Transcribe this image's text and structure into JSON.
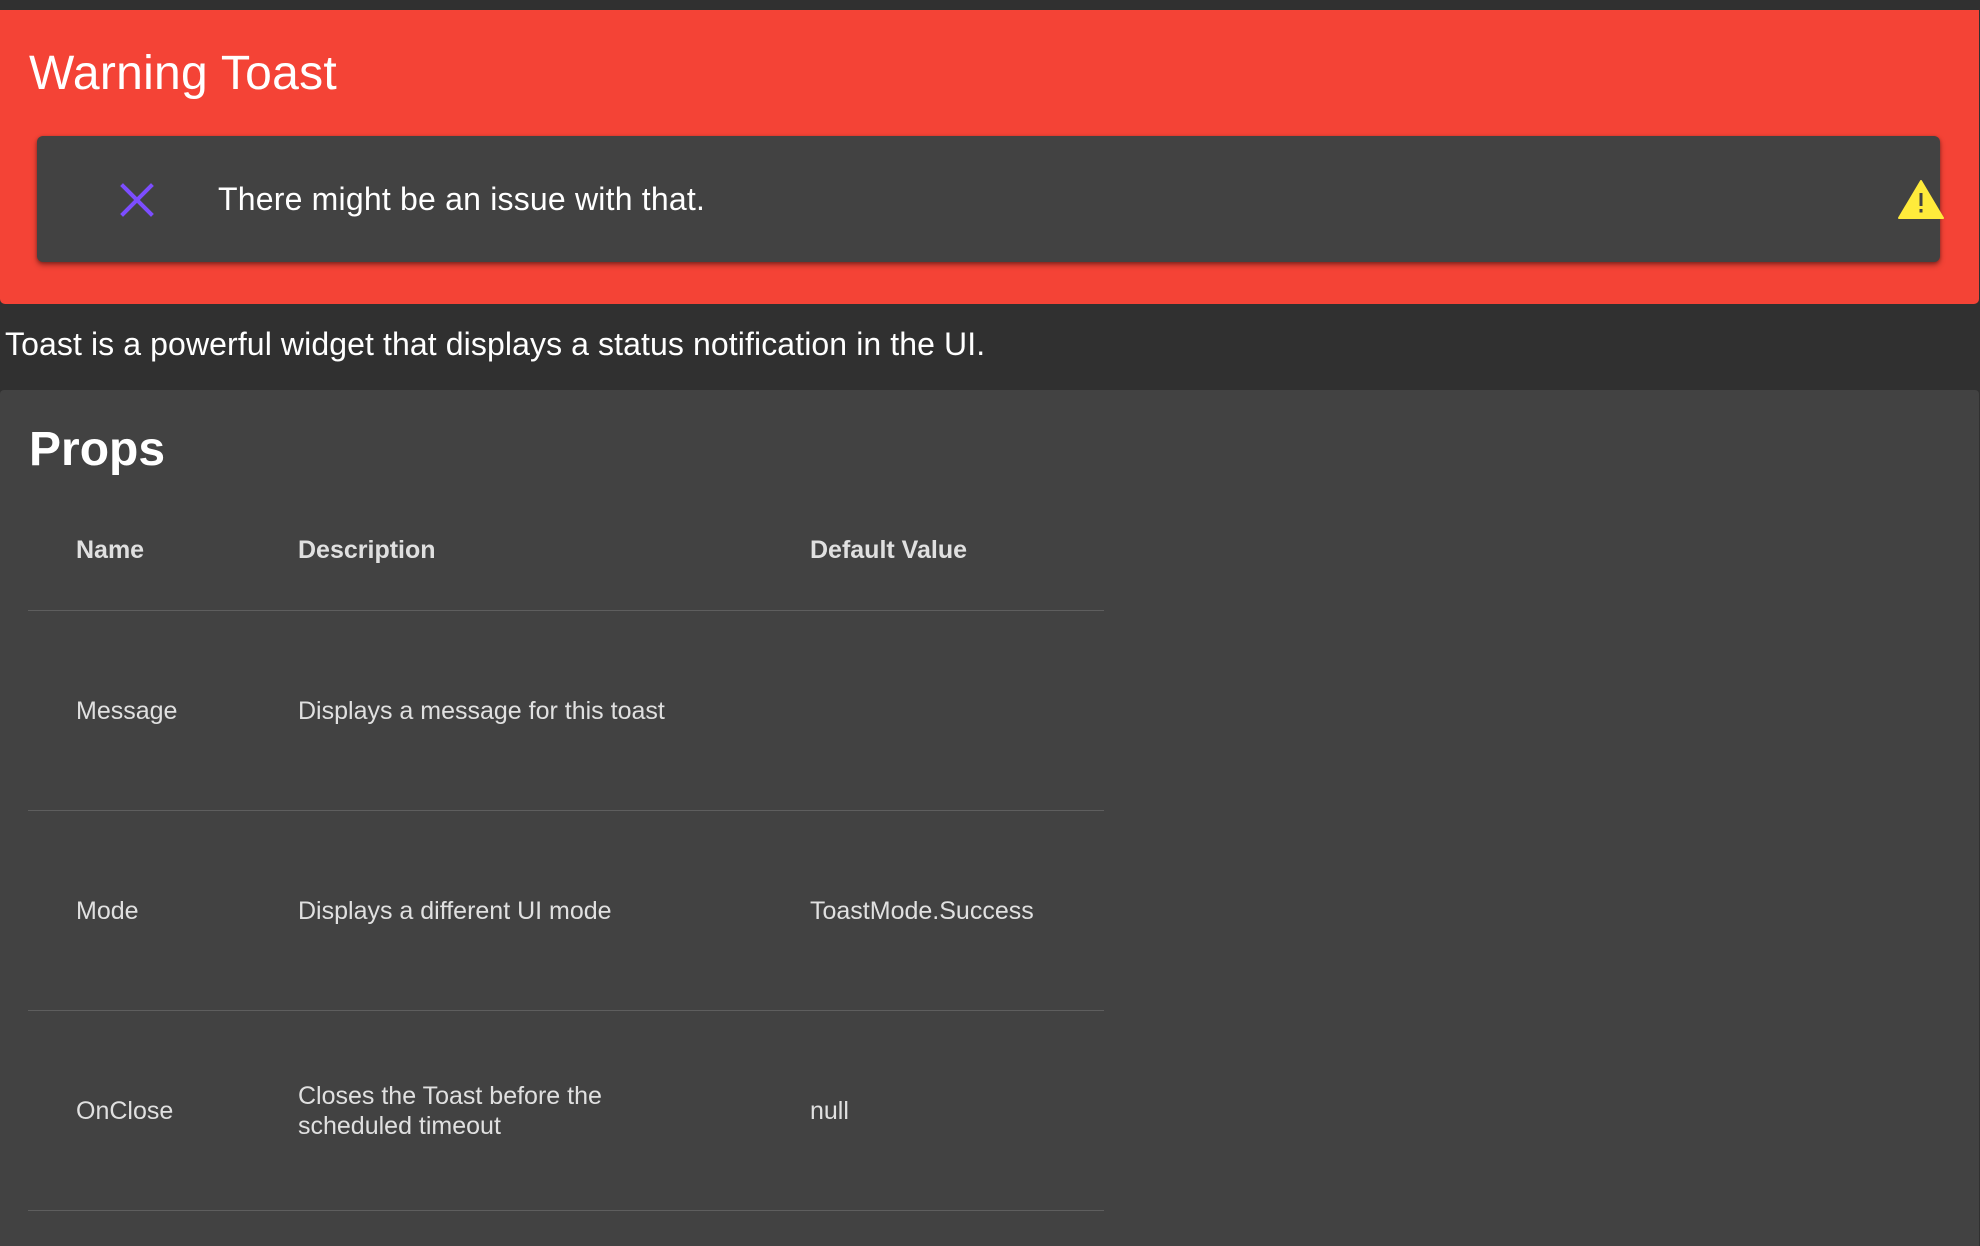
{
  "hero": {
    "title": "Warning Toast",
    "background_color": "#f44336"
  },
  "toast": {
    "message": "There might be an issue with that.",
    "close_icon": "close-x-icon",
    "close_icon_color": "#7c4dff",
    "status_icon": "warning-triangle-icon",
    "status_icon_color": "#ffeb3b"
  },
  "intro_text": "Toast is a powerful widget that displays a status notification in the UI.",
  "props": {
    "title": "Props",
    "columns": [
      "Name",
      "Description",
      "Default Value"
    ],
    "rows": [
      {
        "name": "Message",
        "description": "Displays a message for this toast",
        "default": ""
      },
      {
        "name": "Mode",
        "description": "Displays a different UI mode",
        "default": "ToastMode.Success"
      },
      {
        "name": "OnClose",
        "description": "Closes the Toast before the scheduled timeout",
        "default": "null"
      }
    ]
  }
}
